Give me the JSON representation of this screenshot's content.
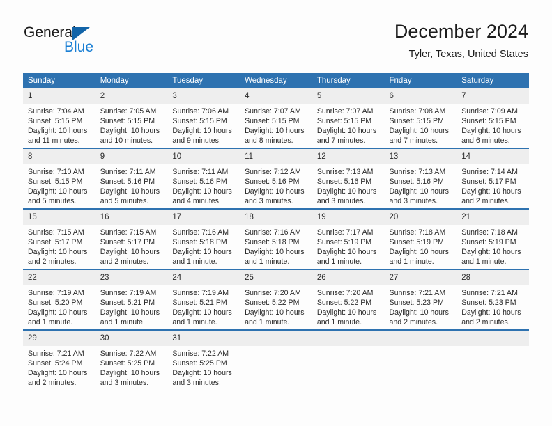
{
  "brand": {
    "name_part1": "General",
    "name_part2": "Blue",
    "triangle_color": "#1264a8",
    "blue_color": "#1a7fd4"
  },
  "header": {
    "title": "December 2024",
    "subtitle": "Tyler, Texas, United States"
  },
  "theme": {
    "header_bg": "#2e72b0",
    "header_text": "#ffffff",
    "daynum_bg": "#eeeeee",
    "text": "#2b2b2b",
    "row_divider": "#2e72b0"
  },
  "calendar": {
    "weekday_headers": [
      "Sunday",
      "Monday",
      "Tuesday",
      "Wednesday",
      "Thursday",
      "Friday",
      "Saturday"
    ],
    "labels": {
      "sunrise": "Sunrise:",
      "sunset": "Sunset:",
      "daylight": "Daylight:"
    },
    "weeks": [
      [
        {
          "day": "1",
          "sunrise": "Sunrise: 7:04 AM",
          "sunset": "Sunset: 5:15 PM",
          "daylight_line1": "Daylight: 10 hours",
          "daylight_line2": "and 11 minutes."
        },
        {
          "day": "2",
          "sunrise": "Sunrise: 7:05 AM",
          "sunset": "Sunset: 5:15 PM",
          "daylight_line1": "Daylight: 10 hours",
          "daylight_line2": "and 10 minutes."
        },
        {
          "day": "3",
          "sunrise": "Sunrise: 7:06 AM",
          "sunset": "Sunset: 5:15 PM",
          "daylight_line1": "Daylight: 10 hours",
          "daylight_line2": "and 9 minutes."
        },
        {
          "day": "4",
          "sunrise": "Sunrise: 7:07 AM",
          "sunset": "Sunset: 5:15 PM",
          "daylight_line1": "Daylight: 10 hours",
          "daylight_line2": "and 8 minutes."
        },
        {
          "day": "5",
          "sunrise": "Sunrise: 7:07 AM",
          "sunset": "Sunset: 5:15 PM",
          "daylight_line1": "Daylight: 10 hours",
          "daylight_line2": "and 7 minutes."
        },
        {
          "day": "6",
          "sunrise": "Sunrise: 7:08 AM",
          "sunset": "Sunset: 5:15 PM",
          "daylight_line1": "Daylight: 10 hours",
          "daylight_line2": "and 7 minutes."
        },
        {
          "day": "7",
          "sunrise": "Sunrise: 7:09 AM",
          "sunset": "Sunset: 5:15 PM",
          "daylight_line1": "Daylight: 10 hours",
          "daylight_line2": "and 6 minutes."
        }
      ],
      [
        {
          "day": "8",
          "sunrise": "Sunrise: 7:10 AM",
          "sunset": "Sunset: 5:15 PM",
          "daylight_line1": "Daylight: 10 hours",
          "daylight_line2": "and 5 minutes."
        },
        {
          "day": "9",
          "sunrise": "Sunrise: 7:11 AM",
          "sunset": "Sunset: 5:16 PM",
          "daylight_line1": "Daylight: 10 hours",
          "daylight_line2": "and 5 minutes."
        },
        {
          "day": "10",
          "sunrise": "Sunrise: 7:11 AM",
          "sunset": "Sunset: 5:16 PM",
          "daylight_line1": "Daylight: 10 hours",
          "daylight_line2": "and 4 minutes."
        },
        {
          "day": "11",
          "sunrise": "Sunrise: 7:12 AM",
          "sunset": "Sunset: 5:16 PM",
          "daylight_line1": "Daylight: 10 hours",
          "daylight_line2": "and 3 minutes."
        },
        {
          "day": "12",
          "sunrise": "Sunrise: 7:13 AM",
          "sunset": "Sunset: 5:16 PM",
          "daylight_line1": "Daylight: 10 hours",
          "daylight_line2": "and 3 minutes."
        },
        {
          "day": "13",
          "sunrise": "Sunrise: 7:13 AM",
          "sunset": "Sunset: 5:16 PM",
          "daylight_line1": "Daylight: 10 hours",
          "daylight_line2": "and 3 minutes."
        },
        {
          "day": "14",
          "sunrise": "Sunrise: 7:14 AM",
          "sunset": "Sunset: 5:17 PM",
          "daylight_line1": "Daylight: 10 hours",
          "daylight_line2": "and 2 minutes."
        }
      ],
      [
        {
          "day": "15",
          "sunrise": "Sunrise: 7:15 AM",
          "sunset": "Sunset: 5:17 PM",
          "daylight_line1": "Daylight: 10 hours",
          "daylight_line2": "and 2 minutes."
        },
        {
          "day": "16",
          "sunrise": "Sunrise: 7:15 AM",
          "sunset": "Sunset: 5:17 PM",
          "daylight_line1": "Daylight: 10 hours",
          "daylight_line2": "and 2 minutes."
        },
        {
          "day": "17",
          "sunrise": "Sunrise: 7:16 AM",
          "sunset": "Sunset: 5:18 PM",
          "daylight_line1": "Daylight: 10 hours",
          "daylight_line2": "and 1 minute."
        },
        {
          "day": "18",
          "sunrise": "Sunrise: 7:16 AM",
          "sunset": "Sunset: 5:18 PM",
          "daylight_line1": "Daylight: 10 hours",
          "daylight_line2": "and 1 minute."
        },
        {
          "day": "19",
          "sunrise": "Sunrise: 7:17 AM",
          "sunset": "Sunset: 5:19 PM",
          "daylight_line1": "Daylight: 10 hours",
          "daylight_line2": "and 1 minute."
        },
        {
          "day": "20",
          "sunrise": "Sunrise: 7:18 AM",
          "sunset": "Sunset: 5:19 PM",
          "daylight_line1": "Daylight: 10 hours",
          "daylight_line2": "and 1 minute."
        },
        {
          "day": "21",
          "sunrise": "Sunrise: 7:18 AM",
          "sunset": "Sunset: 5:19 PM",
          "daylight_line1": "Daylight: 10 hours",
          "daylight_line2": "and 1 minute."
        }
      ],
      [
        {
          "day": "22",
          "sunrise": "Sunrise: 7:19 AM",
          "sunset": "Sunset: 5:20 PM",
          "daylight_line1": "Daylight: 10 hours",
          "daylight_line2": "and 1 minute."
        },
        {
          "day": "23",
          "sunrise": "Sunrise: 7:19 AM",
          "sunset": "Sunset: 5:21 PM",
          "daylight_line1": "Daylight: 10 hours",
          "daylight_line2": "and 1 minute."
        },
        {
          "day": "24",
          "sunrise": "Sunrise: 7:19 AM",
          "sunset": "Sunset: 5:21 PM",
          "daylight_line1": "Daylight: 10 hours",
          "daylight_line2": "and 1 minute."
        },
        {
          "day": "25",
          "sunrise": "Sunrise: 7:20 AM",
          "sunset": "Sunset: 5:22 PM",
          "daylight_line1": "Daylight: 10 hours",
          "daylight_line2": "and 1 minute."
        },
        {
          "day": "26",
          "sunrise": "Sunrise: 7:20 AM",
          "sunset": "Sunset: 5:22 PM",
          "daylight_line1": "Daylight: 10 hours",
          "daylight_line2": "and 1 minute."
        },
        {
          "day": "27",
          "sunrise": "Sunrise: 7:21 AM",
          "sunset": "Sunset: 5:23 PM",
          "daylight_line1": "Daylight: 10 hours",
          "daylight_line2": "and 2 minutes."
        },
        {
          "day": "28",
          "sunrise": "Sunrise: 7:21 AM",
          "sunset": "Sunset: 5:23 PM",
          "daylight_line1": "Daylight: 10 hours",
          "daylight_line2": "and 2 minutes."
        }
      ],
      [
        {
          "day": "29",
          "sunrise": "Sunrise: 7:21 AM",
          "sunset": "Sunset: 5:24 PM",
          "daylight_line1": "Daylight: 10 hours",
          "daylight_line2": "and 2 minutes."
        },
        {
          "day": "30",
          "sunrise": "Sunrise: 7:22 AM",
          "sunset": "Sunset: 5:25 PM",
          "daylight_line1": "Daylight: 10 hours",
          "daylight_line2": "and 3 minutes."
        },
        {
          "day": "31",
          "sunrise": "Sunrise: 7:22 AM",
          "sunset": "Sunset: 5:25 PM",
          "daylight_line1": "Daylight: 10 hours",
          "daylight_line2": "and 3 minutes."
        },
        {
          "day": "",
          "sunrise": "",
          "sunset": "",
          "daylight_line1": "",
          "daylight_line2": ""
        },
        {
          "day": "",
          "sunrise": "",
          "sunset": "",
          "daylight_line1": "",
          "daylight_line2": ""
        },
        {
          "day": "",
          "sunrise": "",
          "sunset": "",
          "daylight_line1": "",
          "daylight_line2": ""
        },
        {
          "day": "",
          "sunrise": "",
          "sunset": "",
          "daylight_line1": "",
          "daylight_line2": ""
        }
      ]
    ]
  }
}
